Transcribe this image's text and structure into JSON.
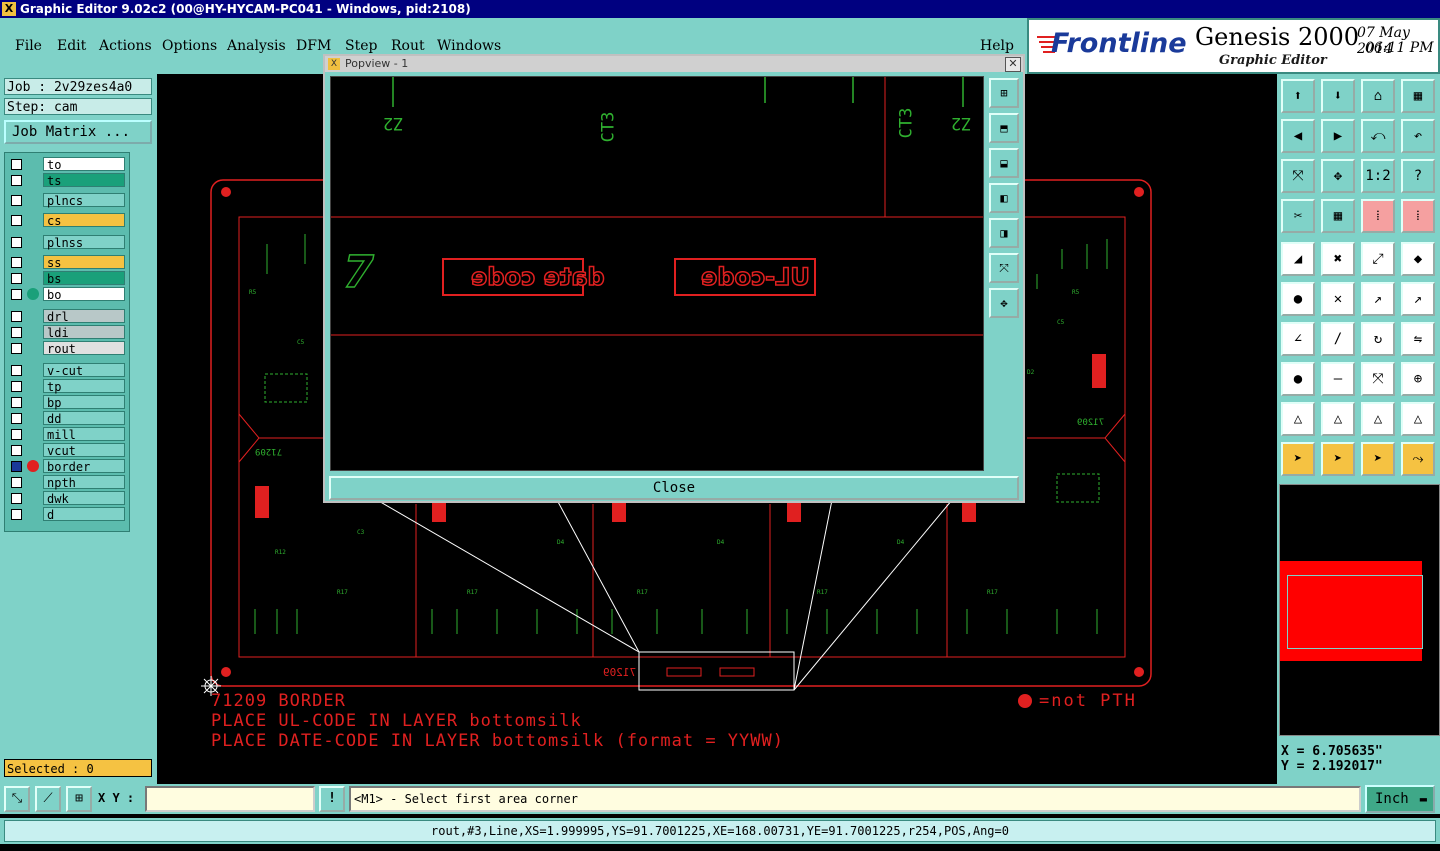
{
  "window_title": "Graphic Editor 9.02c2 (00@HY-HYCAM-PC041 - Windows, pid:2108)",
  "menu": [
    "File",
    "Edit",
    "Actions",
    "Options",
    "Analysis",
    "DFM",
    "Step",
    "Rout",
    "Windows"
  ],
  "help_label": "Help",
  "brand": {
    "logo": "Frontline",
    "product": "Genesis 2000",
    "subtitle": "Graphic Editor",
    "date": "07 May 2014",
    "time": "06:11 PM"
  },
  "job": {
    "job_label": "Job : 2v29zes4a0",
    "step_label": "Step: cam",
    "matrix_button": "Job Matrix ..."
  },
  "layers": [
    {
      "name": "to",
      "color": "#ffffff"
    },
    {
      "name": "ts",
      "color": "#1aa07a"
    },
    {
      "name": "plncs",
      "color": "#7fd2c8"
    },
    {
      "name": "cs",
      "color": "#f5c242"
    },
    {
      "name": "plnss",
      "color": "#7fd2c8"
    },
    {
      "name": "ss",
      "color": "#f5c242"
    },
    {
      "name": "bs",
      "color": "#1aa07a"
    },
    {
      "name": "bo",
      "color": "#ffffff"
    },
    {
      "name": "drl",
      "color": "#b8c8c8"
    },
    {
      "name": "ldi",
      "color": "#b8c8c8"
    },
    {
      "name": "rout",
      "color": "#e0e0e0"
    },
    {
      "name": "v-cut",
      "color": "#7fd2c8"
    },
    {
      "name": "tp",
      "color": "#7fd2c8"
    },
    {
      "name": "bp",
      "color": "#7fd2c8"
    },
    {
      "name": "dd",
      "color": "#7fd2c8"
    },
    {
      "name": "mill",
      "color": "#7fd2c8"
    },
    {
      "name": "vcut",
      "color": "#7fd2c8"
    },
    {
      "name": "border",
      "color": "#7fd2c8"
    },
    {
      "name": "npth",
      "color": "#7fd2c8"
    },
    {
      "name": "dwk",
      "color": "#7fd2c8"
    },
    {
      "name": "d",
      "color": "#7fd2c8"
    }
  ],
  "selected_label": "Selected : 0",
  "popup": {
    "title": "Popview - 1",
    "close_label": "Close",
    "texts": {
      "date_code": "date code",
      "ul_code": "UL-code",
      "c1": "CT3",
      "c2": "CT3",
      "z1": "Z2",
      "z2": "Z2",
      "seven": "7"
    }
  },
  "canvas": {
    "note1": "71209  BORDER",
    "note2": "PLACE UL-CODE IN LAYER bottomsilk",
    "note3": "PLACE DATE-CODE IN LAYER bottomsilk (format = YYWW)",
    "legend": "=not PTH",
    "label_left": "71209",
    "label_right": "71209"
  },
  "coords": {
    "x": "X  =  6.705635\"",
    "y": "Y  =  2.192017\""
  },
  "bottom": {
    "xy_label": "X Y :",
    "excl": "!",
    "prompt": "<M1> - Select first area corner",
    "unit": "Inch"
  },
  "status": "rout,#3,Line,XS=1.999995,YS=91.7001225,XE=168.00731,YE=91.7001225,r254,POS,Ang=0"
}
